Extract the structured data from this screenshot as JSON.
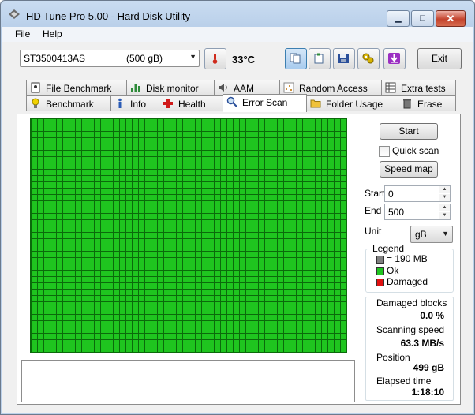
{
  "window": {
    "title": "HD Tune Pro 5.00 - Hard Disk Utility"
  },
  "menu": {
    "file": "File",
    "help": "Help"
  },
  "drive": {
    "name": "ST3500413AS",
    "size": "(500 gB)"
  },
  "temperature": "33",
  "temp_unit": "°C",
  "toolbar": {
    "exit": "Exit"
  },
  "tabs_top": [
    "File Benchmark",
    "Disk monitor",
    "AAM",
    "Random Access",
    "Extra tests"
  ],
  "tabs_bottom": [
    "Benchmark",
    "Info",
    "Health",
    "Error Scan",
    "Folder Usage",
    "Erase"
  ],
  "scan": {
    "start_button": "Start",
    "quick_scan": "Quick scan",
    "speed_map_button": "Speed map",
    "start_label": "Start",
    "start_value": "0",
    "end_label": "End",
    "end_value": "500",
    "unit_label": "Unit",
    "unit_value": "gB"
  },
  "legend": {
    "title": "Legend",
    "block": "= 190 MB",
    "ok": "Ok",
    "damaged": "Damaged",
    "colors": {
      "block": "#808080",
      "ok": "#1fc51f",
      "damaged": "#e01010"
    }
  },
  "stats": {
    "damaged_label": "Damaged blocks",
    "damaged_value": "0.0 %",
    "speed_label": "Scanning speed",
    "speed_value": "63.3 MB/s",
    "position_label": "Position",
    "position_value": "499 gB",
    "elapsed_label": "Elapsed time",
    "elapsed_value": "1:18:10"
  }
}
